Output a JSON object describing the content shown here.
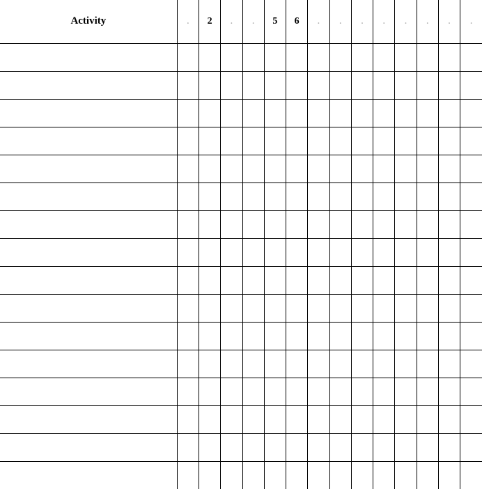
{
  "table": {
    "activity_header": "Activity",
    "columns": [
      {
        "label": "1",
        "visible": false
      },
      {
        "label": "2",
        "visible": true
      },
      {
        "label": "3",
        "visible": false
      },
      {
        "label": "4",
        "visible": false
      },
      {
        "label": "5",
        "visible": true
      },
      {
        "label": "6",
        "visible": true
      },
      {
        "label": "7",
        "visible": false
      },
      {
        "label": "8",
        "visible": false
      },
      {
        "label": "9",
        "visible": false
      },
      {
        "label": "10",
        "visible": false
      },
      {
        "label": "11",
        "visible": false
      },
      {
        "label": "12",
        "visible": false
      },
      {
        "label": "13",
        "visible": false
      },
      {
        "label": "14",
        "visible": false
      }
    ],
    "rows": [
      {
        "activity": ""
      },
      {
        "activity": ""
      },
      {
        "activity": ""
      },
      {
        "activity": ""
      },
      {
        "activity": ""
      },
      {
        "activity": ""
      },
      {
        "activity": ""
      },
      {
        "activity": ""
      },
      {
        "activity": ""
      },
      {
        "activity": ""
      },
      {
        "activity": ""
      },
      {
        "activity": ""
      },
      {
        "activity": ""
      },
      {
        "activity": ""
      },
      {
        "activity": ""
      },
      {
        "activity": ""
      }
    ]
  }
}
